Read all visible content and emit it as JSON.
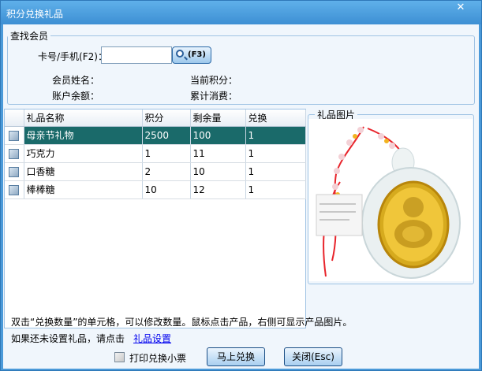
{
  "window": {
    "title": "积分兑换礼品",
    "close_symbol": "✕"
  },
  "member_search": {
    "legend": "查找会员",
    "card_label": "卡号/手机(F2)：",
    "card_value": "",
    "search_button": "(F3)",
    "name_label": "会员姓名：",
    "name_value": "",
    "points_label": "当前积分：",
    "points_value": "",
    "balance_label": "账户余额：",
    "balance_value": "",
    "spent_label": "累计消费：",
    "spent_value": ""
  },
  "gift_table": {
    "columns": [
      "",
      "礼品名称",
      "积分",
      "剩余量",
      "兑换"
    ],
    "rows": [
      {
        "name": "母亲节礼物",
        "points": "2500",
        "remaining": "100",
        "exchange": "1",
        "selected": true
      },
      {
        "name": "巧克力",
        "points": "1",
        "remaining": "11",
        "exchange": "1",
        "selected": false
      },
      {
        "name": "口香糖",
        "points": "2",
        "remaining": "10",
        "exchange": "1",
        "selected": false
      },
      {
        "name": "棒棒糖",
        "points": "10",
        "remaining": "12",
        "exchange": "1",
        "selected": false
      }
    ]
  },
  "picture": {
    "legend": "礼品图片"
  },
  "hints": {
    "line1": "双击“兑换数量”的单元格，可以修改数量。鼠标点击产品，右侧可显示产品图片。",
    "line2_prefix": "如果还未设置礼品，请点击",
    "line2_link": "礼品设置"
  },
  "footer": {
    "print_label": "打印兑换小票",
    "print_checked": false,
    "exchange_button": "马上兑换",
    "close_button": "关闭(Esc)"
  },
  "colors": {
    "title_bar": "#4b9ad9",
    "selected_row": "#1a6a6a",
    "link": "#0000ee"
  }
}
